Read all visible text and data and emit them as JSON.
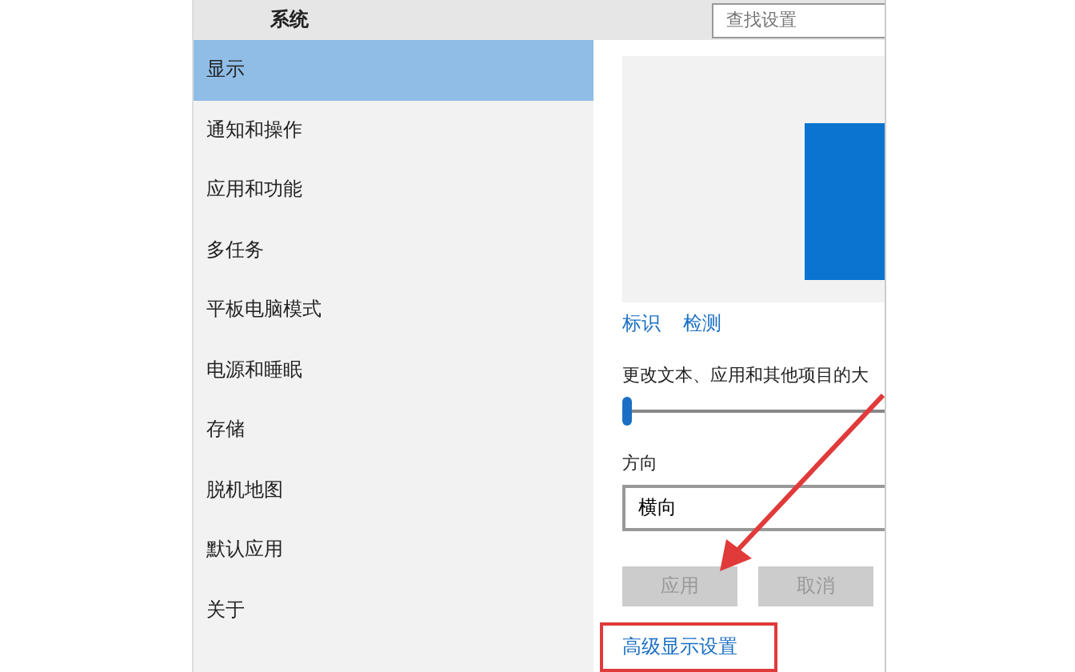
{
  "window": {
    "title": "系统"
  },
  "search": {
    "placeholder": "查找设置"
  },
  "sidebar": {
    "items": [
      {
        "label": "显示",
        "selected": true
      },
      {
        "label": "通知和操作",
        "selected": false
      },
      {
        "label": "应用和功能",
        "selected": false
      },
      {
        "label": "多任务",
        "selected": false
      },
      {
        "label": "平板电脑模式",
        "selected": false
      },
      {
        "label": "电源和睡眠",
        "selected": false
      },
      {
        "label": "存储",
        "selected": false
      },
      {
        "label": "脱机地图",
        "selected": false
      },
      {
        "label": "默认应用",
        "selected": false
      },
      {
        "label": "关于",
        "selected": false
      }
    ]
  },
  "display": {
    "links": [
      "标识",
      "检测"
    ],
    "scale_label": "更改文本、应用和其他项目的大",
    "scale_slider": {
      "level": 0
    },
    "orientation_label": "方向",
    "orientation": {
      "value": "横向"
    },
    "buttons": [
      {
        "label": "应用",
        "disabled": true
      },
      {
        "label": "取消",
        "disabled": true
      }
    ],
    "advanced_link": "高级显示设置"
  }
}
